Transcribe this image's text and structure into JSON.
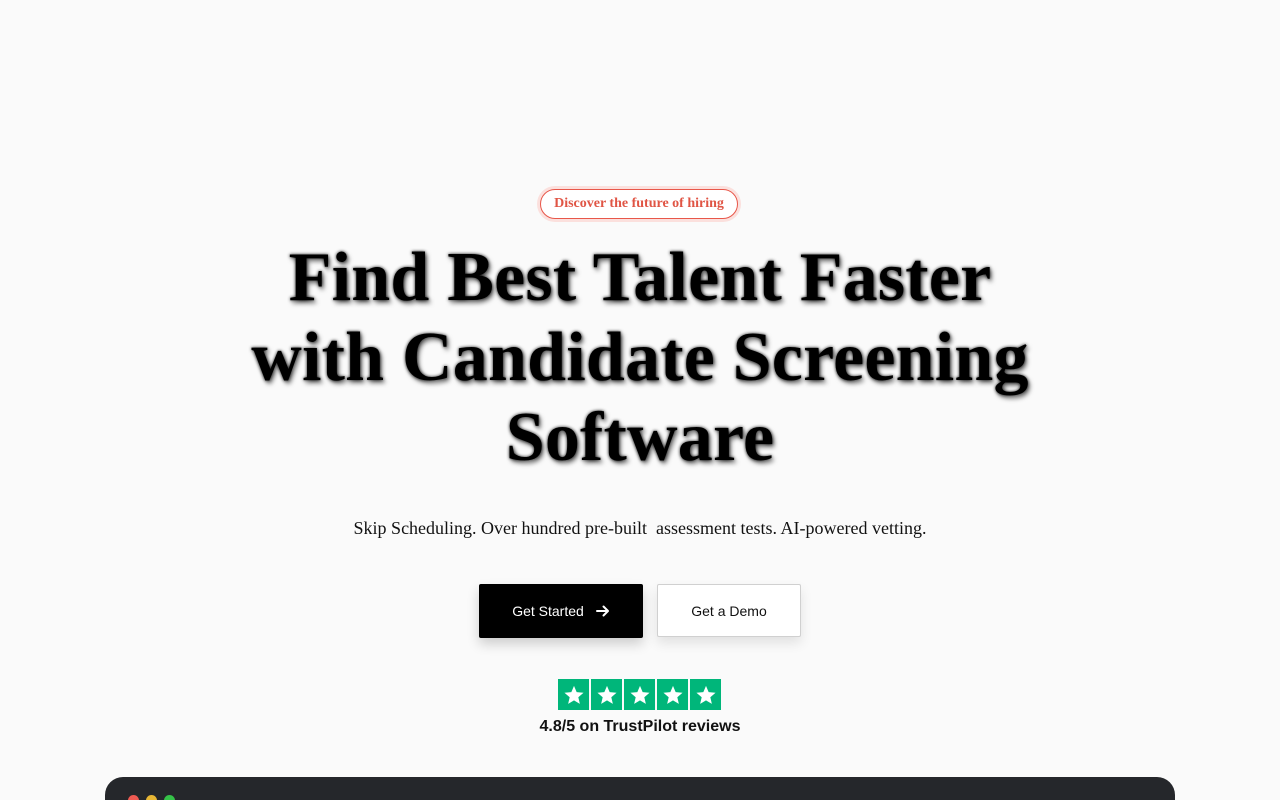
{
  "hero": {
    "badge": "Discover the future of hiring",
    "headline_lines": [
      "Find Best Talent Faster",
      "with Candidate Screening",
      "Software"
    ],
    "subtitle": "Skip Scheduling. Over hundred pre-built  assessment tests. AI-powered vetting."
  },
  "cta": {
    "primary_label": "Get Started",
    "primary_icon": "arrow-right-icon",
    "secondary_label": "Get a Demo"
  },
  "trustpilot": {
    "stars": 5,
    "star_color": "#00b67a",
    "rating_text": "4.8/5 on TrustPilot reviews"
  },
  "colors": {
    "badge_accent": "#e05545",
    "primary_button": "#000000",
    "preview_window": "#25272b"
  }
}
